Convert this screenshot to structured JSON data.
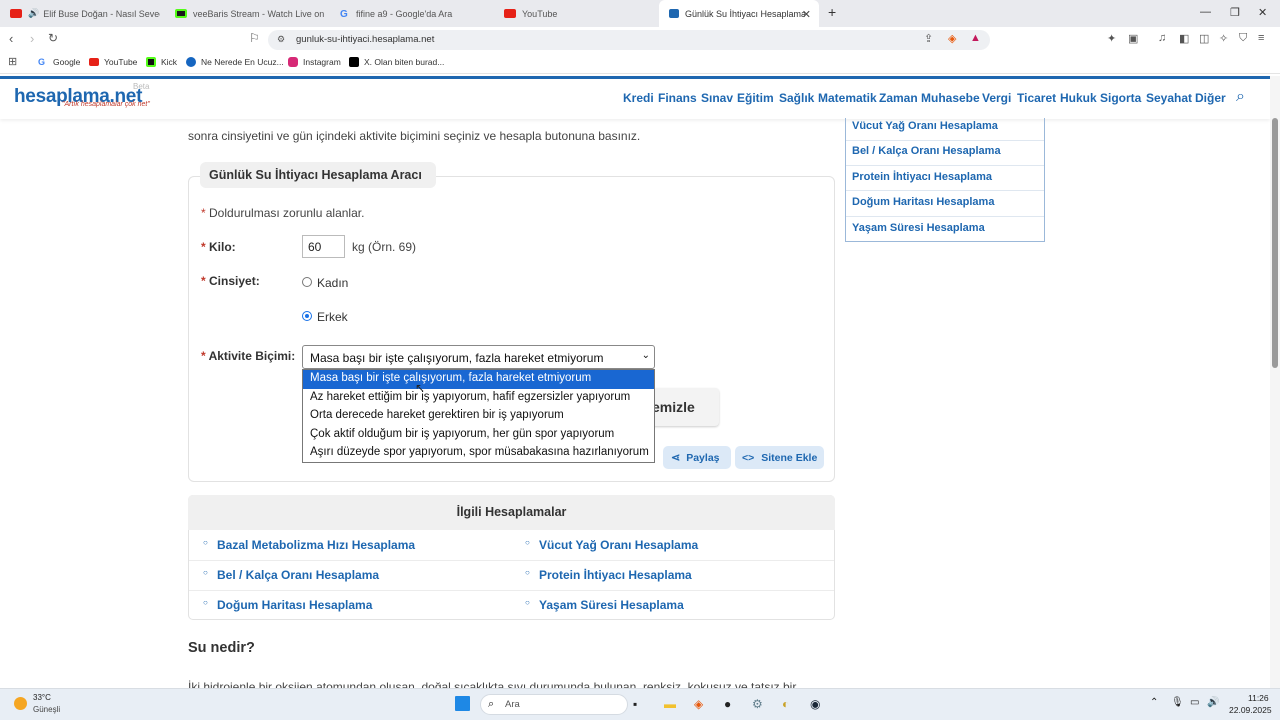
{
  "browser": {
    "tabs": [
      {
        "label": "Elif Buse Doğan - Nasıl Seveceğim",
        "icon": "youtube-icon",
        "audio": "🔊"
      },
      {
        "label": "veeBaris Stream - Watch Live on Kick",
        "icon": "kick-icon"
      },
      {
        "label": "fifine a9 - Google'da Ara",
        "icon": "google-icon"
      },
      {
        "label": "YouTube",
        "icon": "youtube-icon"
      },
      {
        "label": "Günlük Su İhtiyacı Hesaplama - H",
        "icon": "hesaplama-icon"
      }
    ],
    "new_tab": "+",
    "window_controls": {
      "minimize": "—",
      "maximize": "❐",
      "close": "✕"
    },
    "url": "gunluk-su-ihtiyaci.hesaplama.net",
    "bookmarks": [
      {
        "label": "Google"
      },
      {
        "label": "YouTube"
      },
      {
        "label": "Kick"
      },
      {
        "label": "Ne Nerede En Ucuz..."
      },
      {
        "label": "Instagram"
      },
      {
        "label": "X. Olan biten burad..."
      }
    ]
  },
  "site": {
    "logo": "hesaplama.net",
    "logo_beta": "Beta",
    "slogan": "\"Artık hesaplamalar çok net\"",
    "menu": [
      "Kredi",
      "Finans",
      "Sınav",
      "Eğitim",
      "Sağlık",
      "Matematik",
      "Zaman",
      "Muhasebe",
      "Vergi",
      "Ticaret",
      "Hukuk",
      "Sigorta",
      "Seyahat",
      "Diğer"
    ],
    "intro_line": "sonra cinsiyetini ve gün içindeki aktivite biçimini seçiniz ve hesapla butonuna basınız."
  },
  "tool": {
    "title": "Günlük Su İhtiyacı Hesaplama Aracı",
    "required_note": "Doldurulması zorunlu alanlar.",
    "asterisk": "*",
    "kilo_label": "Kilo:",
    "kilo_value": "60",
    "kilo_hint": "kg (Örn. 69)",
    "gender_label": "Cinsiyet:",
    "gender_options": [
      "Kadın",
      "Erkek"
    ],
    "gender_selected": "Erkek",
    "activity_label": "Aktivite Biçimi:",
    "activity_selected": "Masa başı bir işte çalışıyorum, fazla hareket etmiyorum",
    "activity_options": [
      "Masa başı bir işte çalışıyorum, fazla hareket etmiyorum",
      "Az hareket ettiğim bir iş yapıyorum, hafif egzersizler yapıyorum",
      "Orta derecede hareket gerektiren bir iş yapıyorum",
      "Çok aktif olduğum bir iş yapıyorum, her gün spor yapıyorum",
      "Aşırı düzeyde spor yapıyorum, spor müsabakasına hazırlanıyorum"
    ],
    "clear_button": "emizle",
    "share_button": "Paylaş",
    "embed_button": "Sitene Ekle"
  },
  "related": {
    "title": "İlgili Hesaplamalar",
    "left": [
      "Bazal Metabolizma Hızı Hesaplama",
      "Bel / Kalça Oranı Hesaplama",
      "Doğum Haritası Hesaplama"
    ],
    "right": [
      "Vücut Yağ Oranı Hesaplama",
      "Protein İhtiyacı Hesaplama",
      "Yaşam Süresi Hesaplama"
    ]
  },
  "sidebar": {
    "links": [
      "Vücut Yağ Oranı Hesaplama",
      "Bel / Kalça Oranı Hesaplama",
      "Protein İhtiyacı Hesaplama",
      "Doğum Haritası Hesaplama",
      "Yaşam Süresi Hesaplama"
    ]
  },
  "article": {
    "heading": "Su nedir?",
    "first_line": "İki hidrojenle bir oksijen atomundan oluşan, doğal sıcaklıkta sıvı durumunda bulunan, renksiz, kokusuz ve tatsız bir"
  },
  "taskbar": {
    "weather_temp": "33°C",
    "weather_desc": "Güneşli",
    "search_placeholder": "Ara",
    "time": "11:26",
    "date": "22.09.2025"
  }
}
